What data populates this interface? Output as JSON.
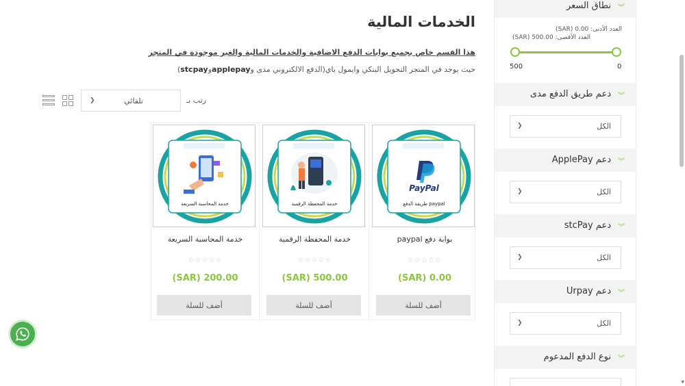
{
  "main": {
    "title": "الخدمات المالية",
    "description_line1": "هذا القسم خاص بجميع بوابات الدفع الاضافية والخدمات المالية والغير موجودة في المتجر",
    "description_line2_prefix": "حيث يوجد في المتجر التحويل البنكي  وايمول باي(الدفع الالكتروني مدى و",
    "description_line2_bold": "applepay",
    "description_line2_mid": "و",
    "description_line2_bold2": "stcpay",
    "description_line2_suffix": ")"
  },
  "toolbar": {
    "sort_label": "رتب بـ",
    "sort_value": "تلقائي",
    "grid_view_icon": "grid-icon",
    "list_view_icon": "list-icon"
  },
  "products": [
    {
      "name": "بوابة دفع paypal",
      "image_caption": "طريقة الدفع paypal",
      "price": "(SAR) 0.00",
      "rating": "☆☆☆☆☆",
      "cart_label": "أضف للسلة"
    },
    {
      "name": "خدمة المحفظة الرقمية",
      "image_caption": "خدمة المحفظة الرقمية",
      "price": "(SAR) 500.00",
      "rating": "☆☆☆☆☆",
      "cart_label": "أضف للسلة"
    },
    {
      "name": "خدمة المحاسبة السريعة",
      "image_caption": "خدمة المحاسبة السريعة",
      "price": "(SAR) 200.00",
      "rating": "☆☆☆☆☆",
      "cart_label": "أضف للسلة"
    }
  ],
  "sidebar": {
    "price_range": {
      "title": "نطاق السعر",
      "min_text": "العدد الأدنى: 0.00 (SAR)",
      "max_text": "العدد الأقصى: 500.00 (SAR)",
      "left_label": "500",
      "right_label": "0"
    },
    "filters": [
      {
        "title": "دعم طريق الدفع مدى",
        "value": "الكل"
      },
      {
        "title": "دعم ApplePay",
        "value": "الكل"
      },
      {
        "title": "دعم stcPay",
        "value": "الكل"
      },
      {
        "title": "دعم Urpay",
        "value": "الكل"
      },
      {
        "title": "نوع الدفع المدعوم",
        "value": ""
      }
    ]
  },
  "colors": {
    "accent": "#8cc63f",
    "teal": "#1aa3a3",
    "whatsapp": "#4caf50"
  }
}
